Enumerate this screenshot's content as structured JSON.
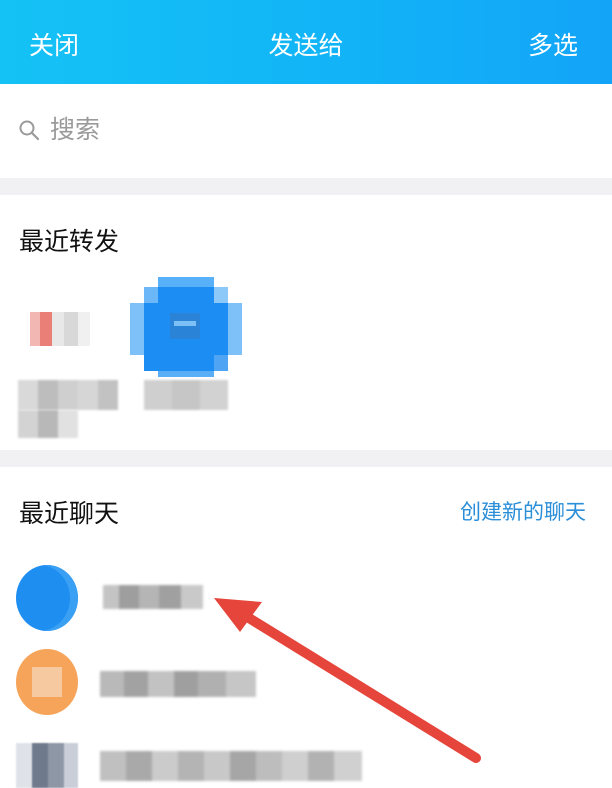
{
  "header": {
    "close_label": "关闭",
    "title": "发送给",
    "multi_select_label": "多选"
  },
  "search": {
    "placeholder": "搜索",
    "icon": "search-icon"
  },
  "recent_forward": {
    "title": "最近转发",
    "items": [
      {
        "avatar_color": "#e9e9e9"
      },
      {
        "avatar_color": "#1c8ef3"
      }
    ]
  },
  "recent_chats": {
    "title": "最近聊天",
    "create_label": "创建新的聊天",
    "items": [
      {
        "avatar_color": "#1f8ef1"
      },
      {
        "avatar_color": "#f6a45a"
      },
      {
        "avatar_color": "#8e97a6"
      }
    ]
  },
  "colors": {
    "header_start": "#14c2f5",
    "header_end": "#13a4f8",
    "link": "#2a8ed8",
    "annotation_arrow": "#e5453a"
  }
}
